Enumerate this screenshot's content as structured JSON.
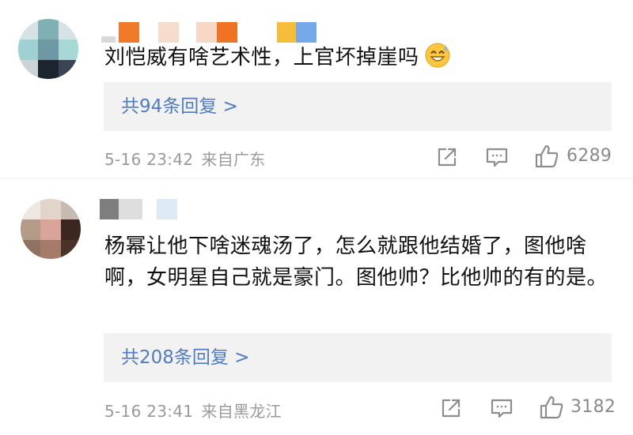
{
  "comments": [
    {
      "text": "刘恺威有啥艺术性，上官坏掉崖吗",
      "emoji": "grinning-sweat-emoji",
      "replies_label": "共94条回复 >",
      "time": "5-16 23:42",
      "source": "来自广东",
      "likes": "6289"
    },
    {
      "text": "杨幂让他下啥迷魂汤了，怎么就跟他结婚了，图他啥啊，女明星自己就是豪门。图他帅？比他帅的有的是。",
      "replies_label": "共208条回复 >",
      "time": "5-16 23:41",
      "source": "来自黑龙江",
      "likes": "3182"
    }
  ],
  "icons": {
    "share": "share-icon",
    "comment": "comment-icon",
    "like": "thumbs-up-icon"
  },
  "colors": {
    "reply_link": "#4f7cc4",
    "reply_bg": "#f2f2f2",
    "meta_text": "#9a9a9a",
    "body_text": "#111111"
  }
}
